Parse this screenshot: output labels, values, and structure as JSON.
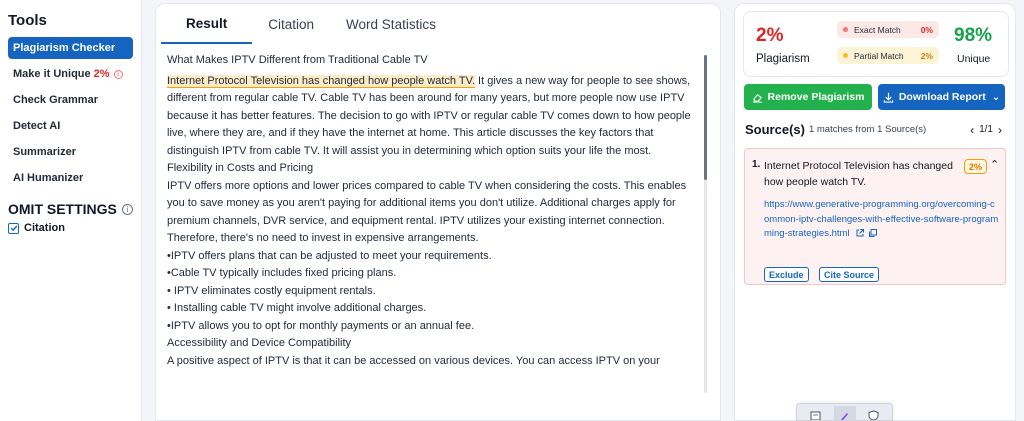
{
  "tools": {
    "title": "Tools",
    "items": [
      {
        "label": "Plagiarism Checker",
        "active": true
      },
      {
        "label": "Make it Unique",
        "badge": "2%"
      },
      {
        "label": "Check Grammar"
      },
      {
        "label": "Detect AI"
      },
      {
        "label": "Summarizer"
      },
      {
        "label": "AI Humanizer"
      }
    ],
    "omit_title": "OMIT SETTINGS",
    "citation_label": "Citation",
    "citation_checked": true
  },
  "tabs": [
    "Result",
    "Citation",
    "Word Statistics"
  ],
  "active_tab": "Result",
  "content": {
    "heading": "What Makes IPTV Different from Traditional Cable TV",
    "highlight": "Internet Protocol Television has changed how people watch TV.",
    "para1_rest": " It gives a new way for people to see shows, different from regular cable TV. Cable TV has been around for many years, but more people now use IPTV because it has better features. The decision to go with IPTV or regular cable TV comes down to how people live, where they are, and if they have the internet at home. This article discusses the key factors that distinguish IPTV from cable TV. It will assist you in determining which option suits your life the most.",
    "subheading1": "Flexibility in Costs and Pricing",
    "para2": "IPTV offers more options and lower prices compared to cable TV when considering the costs. This enables you to save money as you aren't paying for additional items you don't utilize. Additional charges apply for premium channels, DVR service, and equipment rental. IPTV utilizes your existing internet connection. Therefore, there's no need to invest in expensive arrangements.",
    "bullets": [
      "•IPTV offers plans that can be adjusted to meet your requirements.",
      "•Cable TV typically includes fixed pricing plans.",
      "• IPTV eliminates costly equipment rentals.",
      "• Installing cable TV might involve additional charges.",
      "•IPTV allows you to opt for monthly payments or an annual fee."
    ],
    "subheading2": "Accessibility and Device Compatibility",
    "para3": "A positive aspect of IPTV is that it can be accessed on various devices. You can access IPTV on your"
  },
  "scores": {
    "plagiarism_pct": "2%",
    "plagiarism_label": "Plagiarism",
    "exact_label": "Exact Match",
    "exact_pct": "0%",
    "partial_label": "Partial Match",
    "partial_pct": "2%",
    "unique_pct": "98%",
    "unique_label": "Unique"
  },
  "actions": {
    "remove_label": "Remove Plagiarism",
    "download_label": "Download Report"
  },
  "sources": {
    "title": "Source(s)",
    "subtitle": "1 matches from 1 Source(s)",
    "pager": "1/1",
    "items": [
      {
        "num": "1.",
        "title": "Internet Protocol Television has changed how people watch TV.",
        "pct": "2%",
        "url": "https://www.generative-programming.org/overcoming-common-iptv-challenges-with-effective-software-programming-strategies.html",
        "exclude_label": "Exclude",
        "cite_label": "Cite Source"
      }
    ]
  },
  "colors": {
    "accent": "#1565c0",
    "danger": "#dc2626",
    "success": "#22b14c",
    "warning": "#f59e0b"
  }
}
